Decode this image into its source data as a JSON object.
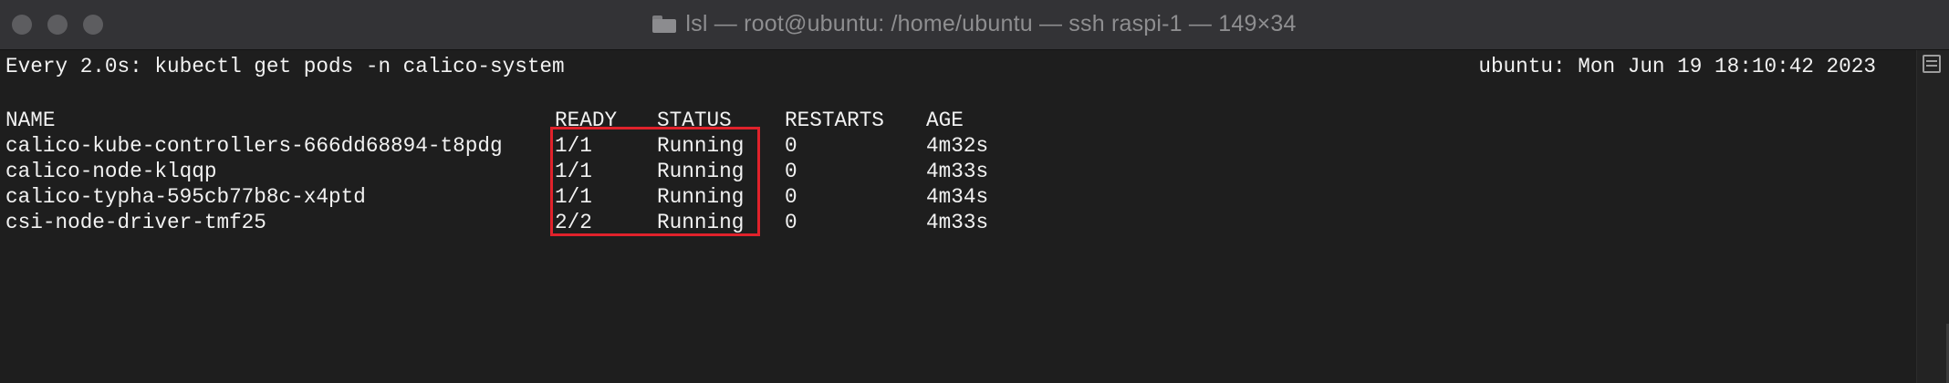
{
  "window": {
    "title": "lsl — root@ubuntu: /home/ubuntu — ssh raspi-1 — 149×34",
    "folder_icon": "folder-icon"
  },
  "terminal": {
    "watch_command": "Every 2.0s: kubectl get pods -n calico-system",
    "clock": "ubuntu: Mon Jun 19 18:10:42 2023",
    "headers": {
      "name": "NAME",
      "ready": "READY",
      "status": "STATUS",
      "restarts": "RESTARTS",
      "age": "AGE"
    },
    "pods": [
      {
        "name": "calico-kube-controllers-666dd68894-t8pdg",
        "ready": "1/1",
        "status": "Running",
        "restarts": "0",
        "age": "4m32s"
      },
      {
        "name": "calico-node-klqqp",
        "ready": "1/1",
        "status": "Running",
        "restarts": "0",
        "age": "4m33s"
      },
      {
        "name": "calico-typha-595cb77b8c-x4ptd",
        "ready": "1/1",
        "status": "Running",
        "restarts": "0",
        "age": "4m34s"
      },
      {
        "name": "csi-node-driver-tmf25",
        "ready": "2/2",
        "status": "Running",
        "restarts": "0",
        "age": "4m33s"
      }
    ]
  },
  "colors": {
    "highlight": "#e0222b",
    "text": "#f2f2f2",
    "background": "#1e1e1e"
  }
}
